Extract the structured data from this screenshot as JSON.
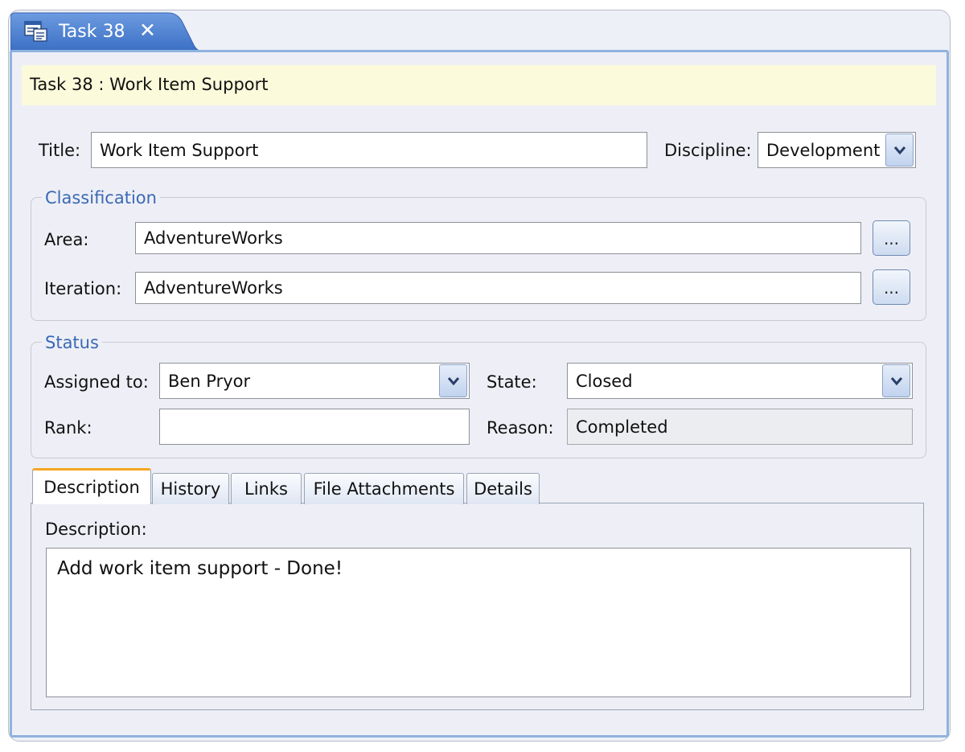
{
  "window": {
    "tab_label": "Task 38",
    "tab_close": "✕",
    "header": "Task 38 : Work Item Support"
  },
  "form": {
    "title_label": "Title:",
    "title_value": "Work Item Support",
    "discipline_label": "Discipline:",
    "discipline_value": "Development"
  },
  "classification": {
    "legend": "Classification",
    "area_label": "Area:",
    "area_value": "AdventureWorks",
    "iteration_label": "Iteration:",
    "iteration_value": "AdventureWorks",
    "browse_label": "..."
  },
  "status": {
    "legend": "Status",
    "assigned_label": "Assigned to:",
    "assigned_value": "Ben Pryor",
    "state_label": "State:",
    "state_value": "Closed",
    "rank_label": "Rank:",
    "rank_value": "",
    "reason_label": "Reason:",
    "reason_value": "Completed"
  },
  "tabs": [
    {
      "label": "Description"
    },
    {
      "label": "History"
    },
    {
      "label": "Links"
    },
    {
      "label": "File Attachments"
    },
    {
      "label": "Details"
    }
  ],
  "description": {
    "label": "Description:",
    "value": "Add work item support - Done!"
  },
  "icons": {
    "tab_icon": "work-item-form-icon",
    "dropdown": "chevron-down-icon"
  },
  "colors": {
    "header_bg": "#fbfadb",
    "group_title": "#3a69b4",
    "tab_blue": "#4a7fd0",
    "active_tab_accent": "#f5a623"
  }
}
